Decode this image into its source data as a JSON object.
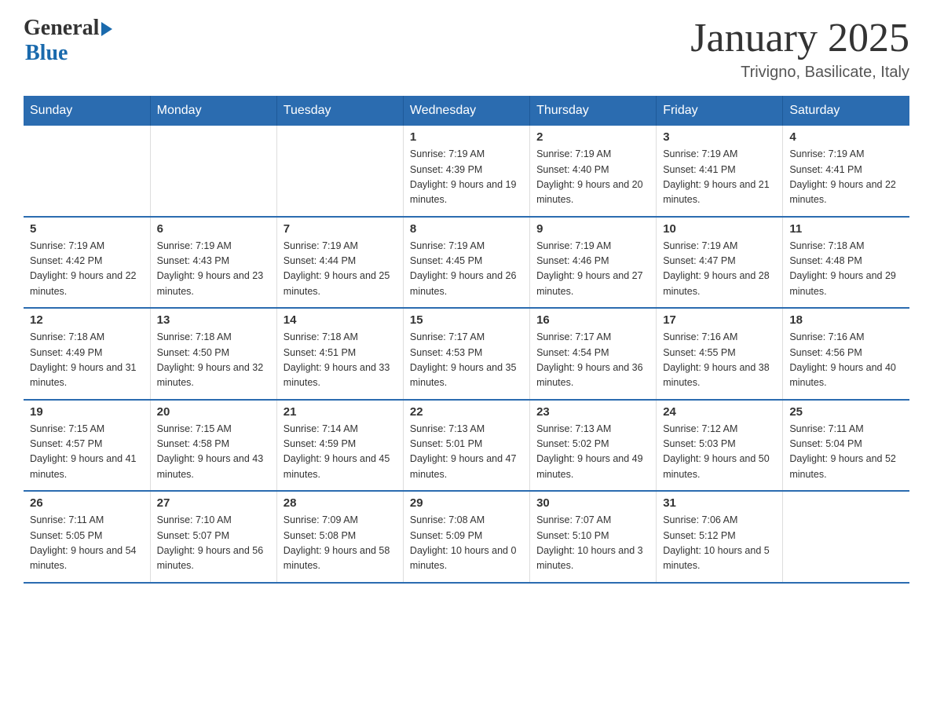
{
  "header": {
    "logo_general": "General",
    "logo_blue": "Blue",
    "month_title": "January 2025",
    "location": "Trivigno, Basilicate, Italy"
  },
  "days_of_week": [
    "Sunday",
    "Monday",
    "Tuesday",
    "Wednesday",
    "Thursday",
    "Friday",
    "Saturday"
  ],
  "weeks": [
    [
      {
        "day": "",
        "sunrise": "",
        "sunset": "",
        "daylight": ""
      },
      {
        "day": "",
        "sunrise": "",
        "sunset": "",
        "daylight": ""
      },
      {
        "day": "",
        "sunrise": "",
        "sunset": "",
        "daylight": ""
      },
      {
        "day": "1",
        "sunrise": "Sunrise: 7:19 AM",
        "sunset": "Sunset: 4:39 PM",
        "daylight": "Daylight: 9 hours and 19 minutes."
      },
      {
        "day": "2",
        "sunrise": "Sunrise: 7:19 AM",
        "sunset": "Sunset: 4:40 PM",
        "daylight": "Daylight: 9 hours and 20 minutes."
      },
      {
        "day": "3",
        "sunrise": "Sunrise: 7:19 AM",
        "sunset": "Sunset: 4:41 PM",
        "daylight": "Daylight: 9 hours and 21 minutes."
      },
      {
        "day": "4",
        "sunrise": "Sunrise: 7:19 AM",
        "sunset": "Sunset: 4:41 PM",
        "daylight": "Daylight: 9 hours and 22 minutes."
      }
    ],
    [
      {
        "day": "5",
        "sunrise": "Sunrise: 7:19 AM",
        "sunset": "Sunset: 4:42 PM",
        "daylight": "Daylight: 9 hours and 22 minutes."
      },
      {
        "day": "6",
        "sunrise": "Sunrise: 7:19 AM",
        "sunset": "Sunset: 4:43 PM",
        "daylight": "Daylight: 9 hours and 23 minutes."
      },
      {
        "day": "7",
        "sunrise": "Sunrise: 7:19 AM",
        "sunset": "Sunset: 4:44 PM",
        "daylight": "Daylight: 9 hours and 25 minutes."
      },
      {
        "day": "8",
        "sunrise": "Sunrise: 7:19 AM",
        "sunset": "Sunset: 4:45 PM",
        "daylight": "Daylight: 9 hours and 26 minutes."
      },
      {
        "day": "9",
        "sunrise": "Sunrise: 7:19 AM",
        "sunset": "Sunset: 4:46 PM",
        "daylight": "Daylight: 9 hours and 27 minutes."
      },
      {
        "day": "10",
        "sunrise": "Sunrise: 7:19 AM",
        "sunset": "Sunset: 4:47 PM",
        "daylight": "Daylight: 9 hours and 28 minutes."
      },
      {
        "day": "11",
        "sunrise": "Sunrise: 7:18 AM",
        "sunset": "Sunset: 4:48 PM",
        "daylight": "Daylight: 9 hours and 29 minutes."
      }
    ],
    [
      {
        "day": "12",
        "sunrise": "Sunrise: 7:18 AM",
        "sunset": "Sunset: 4:49 PM",
        "daylight": "Daylight: 9 hours and 31 minutes."
      },
      {
        "day": "13",
        "sunrise": "Sunrise: 7:18 AM",
        "sunset": "Sunset: 4:50 PM",
        "daylight": "Daylight: 9 hours and 32 minutes."
      },
      {
        "day": "14",
        "sunrise": "Sunrise: 7:18 AM",
        "sunset": "Sunset: 4:51 PM",
        "daylight": "Daylight: 9 hours and 33 minutes."
      },
      {
        "day": "15",
        "sunrise": "Sunrise: 7:17 AM",
        "sunset": "Sunset: 4:53 PM",
        "daylight": "Daylight: 9 hours and 35 minutes."
      },
      {
        "day": "16",
        "sunrise": "Sunrise: 7:17 AM",
        "sunset": "Sunset: 4:54 PM",
        "daylight": "Daylight: 9 hours and 36 minutes."
      },
      {
        "day": "17",
        "sunrise": "Sunrise: 7:16 AM",
        "sunset": "Sunset: 4:55 PM",
        "daylight": "Daylight: 9 hours and 38 minutes."
      },
      {
        "day": "18",
        "sunrise": "Sunrise: 7:16 AM",
        "sunset": "Sunset: 4:56 PM",
        "daylight": "Daylight: 9 hours and 40 minutes."
      }
    ],
    [
      {
        "day": "19",
        "sunrise": "Sunrise: 7:15 AM",
        "sunset": "Sunset: 4:57 PM",
        "daylight": "Daylight: 9 hours and 41 minutes."
      },
      {
        "day": "20",
        "sunrise": "Sunrise: 7:15 AM",
        "sunset": "Sunset: 4:58 PM",
        "daylight": "Daylight: 9 hours and 43 minutes."
      },
      {
        "day": "21",
        "sunrise": "Sunrise: 7:14 AM",
        "sunset": "Sunset: 4:59 PM",
        "daylight": "Daylight: 9 hours and 45 minutes."
      },
      {
        "day": "22",
        "sunrise": "Sunrise: 7:13 AM",
        "sunset": "Sunset: 5:01 PM",
        "daylight": "Daylight: 9 hours and 47 minutes."
      },
      {
        "day": "23",
        "sunrise": "Sunrise: 7:13 AM",
        "sunset": "Sunset: 5:02 PM",
        "daylight": "Daylight: 9 hours and 49 minutes."
      },
      {
        "day": "24",
        "sunrise": "Sunrise: 7:12 AM",
        "sunset": "Sunset: 5:03 PM",
        "daylight": "Daylight: 9 hours and 50 minutes."
      },
      {
        "day": "25",
        "sunrise": "Sunrise: 7:11 AM",
        "sunset": "Sunset: 5:04 PM",
        "daylight": "Daylight: 9 hours and 52 minutes."
      }
    ],
    [
      {
        "day": "26",
        "sunrise": "Sunrise: 7:11 AM",
        "sunset": "Sunset: 5:05 PM",
        "daylight": "Daylight: 9 hours and 54 minutes."
      },
      {
        "day": "27",
        "sunrise": "Sunrise: 7:10 AM",
        "sunset": "Sunset: 5:07 PM",
        "daylight": "Daylight: 9 hours and 56 minutes."
      },
      {
        "day": "28",
        "sunrise": "Sunrise: 7:09 AM",
        "sunset": "Sunset: 5:08 PM",
        "daylight": "Daylight: 9 hours and 58 minutes."
      },
      {
        "day": "29",
        "sunrise": "Sunrise: 7:08 AM",
        "sunset": "Sunset: 5:09 PM",
        "daylight": "Daylight: 10 hours and 0 minutes."
      },
      {
        "day": "30",
        "sunrise": "Sunrise: 7:07 AM",
        "sunset": "Sunset: 5:10 PM",
        "daylight": "Daylight: 10 hours and 3 minutes."
      },
      {
        "day": "31",
        "sunrise": "Sunrise: 7:06 AM",
        "sunset": "Sunset: 5:12 PM",
        "daylight": "Daylight: 10 hours and 5 minutes."
      },
      {
        "day": "",
        "sunrise": "",
        "sunset": "",
        "daylight": ""
      }
    ]
  ]
}
